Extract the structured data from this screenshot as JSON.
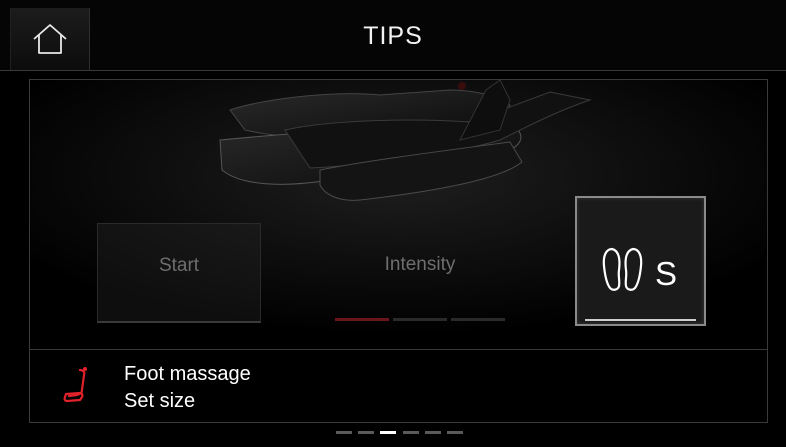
{
  "header": {
    "title": "TIPS",
    "home_icon": "home-icon"
  },
  "controls": {
    "start_label": "Start",
    "intensity_label": "Intensity",
    "intensity_levels_active": 1,
    "intensity_levels_total": 3,
    "size_letter": "S",
    "size_icon": "feet-icon"
  },
  "info": {
    "icon": "seat-icon",
    "line1": "Foot massage",
    "line2": "Set size"
  },
  "pager": {
    "total": 6,
    "active_index": 2
  },
  "colors": {
    "accent_red": "#e0222b",
    "background": "#000000",
    "frame": "#3a3a3a"
  }
}
